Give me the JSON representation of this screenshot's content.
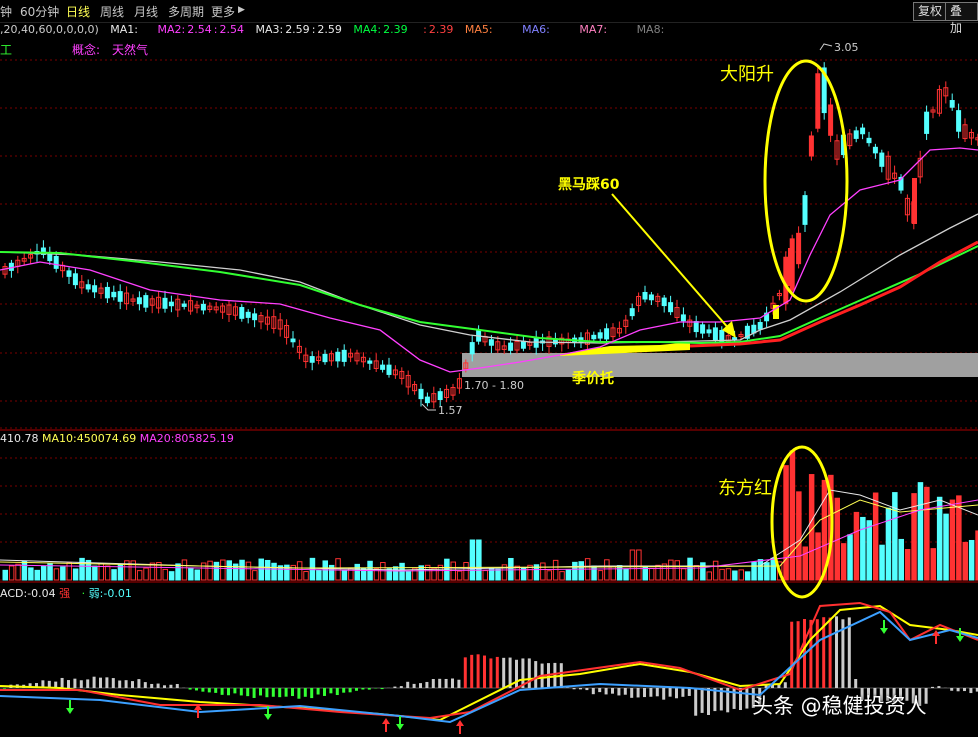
{
  "toolbar": {
    "tabs": [
      {
        "label": "钟",
        "active": false
      },
      {
        "label": "60分钟",
        "active": false
      },
      {
        "label": "日线",
        "active": true
      },
      {
        "label": "周线",
        "active": false
      },
      {
        "label": "月线",
        "active": false
      },
      {
        "label": "多周期",
        "active": false
      },
      {
        "label": "更多",
        "active": false
      }
    ],
    "more_arrow": "▶",
    "restore_label": "复权",
    "overlay_label": "叠加"
  },
  "ma_legend": {
    "params": ",20,40,60,0,0,0,0)",
    "items": [
      {
        "label": "MA1:",
        "value": "",
        "color": "#e8e8e8"
      },
      {
        "label": "MA2:",
        "value": "2.54",
        "color": "#ff40ff"
      },
      {
        "label": "MA3:",
        "value": "2.59",
        "color": "#e8e8e8"
      },
      {
        "label": "MA4:",
        "value": "2.39",
        "color": "#00ff40"
      },
      {
        "label": "",
        "value": "2.39",
        "color": "#ff4040"
      },
      {
        "label": "MA5:",
        "value": "",
        "color": "#ff8040"
      },
      {
        "label": "MA6:",
        "value": "",
        "color": "#8080ff"
      },
      {
        "label": "MA7:",
        "value": "",
        "color": "#ff80c0"
      },
      {
        "label": "MA8:",
        "value": "",
        "color": "#808080"
      }
    ]
  },
  "sector": {
    "industry_fragment": "工",
    "concept_label": "概念:",
    "concept_value": "天然气"
  },
  "price_annotations": {
    "high": "3.05",
    "low": "1.57",
    "range": "1.70 - 1.80"
  },
  "notes": {
    "sun_rise": "大阳升",
    "dark_horse": "黑马踩60",
    "support": "季价托",
    "red_east": "东方红"
  },
  "volume_legend": {
    "ma5": "410.78",
    "ma10_label": "MA10:",
    "ma10": "450074.69",
    "ma20_label": "MA20:",
    "ma20": "805825.19"
  },
  "macd_legend": {
    "macd_label": "ACD:",
    "macd": "-0.04",
    "strong_label": "强",
    "weak_label": "弱:",
    "weak": "-0.01"
  },
  "watermark": "头条 @稳健投资人",
  "colors": {
    "up": "#ff3232",
    "down": "#54ffff",
    "ma_white": "#d0d0d0",
    "ma_magenta": "#ff40ff",
    "ma_green": "#32ff32",
    "ma_red": "#ff2020",
    "note_yellow": "#ffff00",
    "grid": "#7a0000",
    "support_band": "#a0a0a0"
  },
  "chart_data": [
    {
      "type": "candlestick",
      "panel": "price",
      "overlays": [
        "MA20 (magenta)",
        "MA40 (white)",
        "MA60 (green)",
        "MA120 (red)"
      ],
      "annotated_values": {
        "high": 3.05,
        "low": 1.57,
        "support_range": [
          1.7,
          1.8
        ]
      },
      "last_values": {
        "MA2": 2.54,
        "MA3": 2.59,
        "MA4": 2.39
      }
    },
    {
      "type": "bar",
      "panel": "volume",
      "ma": {
        "MA10": 450074.69,
        "MA20": 805825.19
      }
    },
    {
      "type": "bar",
      "panel": "macd",
      "values": {
        "MACD": -0.04,
        "weak": -0.01
      }
    }
  ]
}
